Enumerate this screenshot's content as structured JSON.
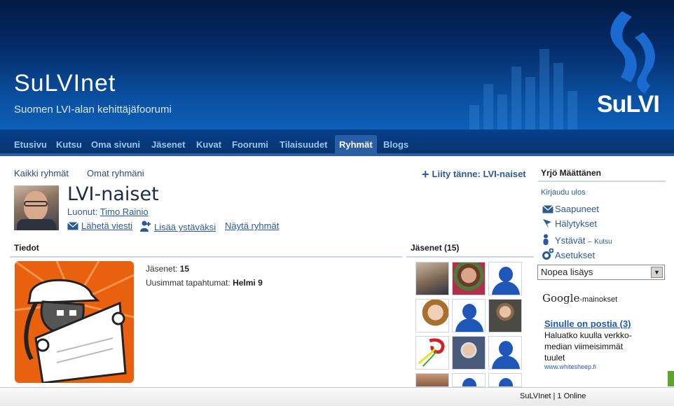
{
  "header": {
    "site_title": "SuLVInet",
    "site_subtitle": "Suomen LVI-alan kehittäjäfoorumi",
    "logo_text": "SuLVI"
  },
  "nav": {
    "items": [
      "Etusivu",
      "Kutsu",
      "Oma sivuni",
      "Jäsenet",
      "Kuvat",
      "Foorumi",
      "Tilaisuudet",
      "Ryhmät",
      "Blogs"
    ],
    "active": "Ryhmät"
  },
  "subnav": {
    "all_groups": "Kaikki ryhmät",
    "my_groups": "Omat ryhmäni",
    "join": "Liity tänne: LVI-naiset"
  },
  "group": {
    "title": "LVI-naiset",
    "created_by_label": "Luonut:",
    "created_by": "Timo Rainio",
    "send_message": "Lähetä viesti",
    "add_friend": "Lisää ystäväksi",
    "show_groups": "Näytä ryhmät"
  },
  "info": {
    "heading": "Tiedot",
    "members_label": "Jäsenet:",
    "members_value": "15",
    "latest_label": "Uusimmat tapahtumat:",
    "latest_value": "Helmi 9"
  },
  "members": {
    "heading": "Jäsenet (15)"
  },
  "sidebar": {
    "user": "Yrjö Määttänen",
    "logout": "Kirjaudu ulos",
    "inbox": "Saapuneet",
    "alerts": "Hälytykset",
    "friends": "Ystävät",
    "friends_sep": "–",
    "invite": "Kutsu",
    "settings": "Asetukset",
    "quick_add": "Nopea lisäys"
  },
  "ads": {
    "google_word": "Google",
    "label": "-mainokset",
    "title": "Sinulle on postia (3)",
    "text": "Haluatko kuulla verkko-median viimeisimmät tuulet",
    "url": "www.whitesheep.fi"
  },
  "footer": {
    "text": "SuLVInet | 1 Online"
  },
  "colors": {
    "header_dark": "#021a44",
    "nav_bg": "#06346f",
    "nav_active": "#2a5ea6",
    "link": "#2b5a9a",
    "accent_orange": "#e9600f"
  }
}
